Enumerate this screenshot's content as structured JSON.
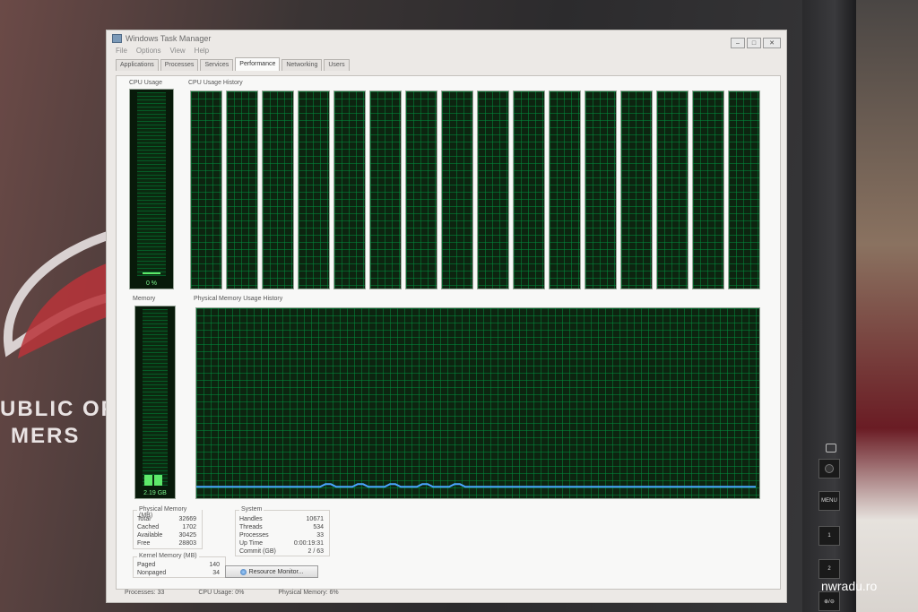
{
  "wallpaper": {
    "line1": "UBLIC OF",
    "line2": "MERS"
  },
  "monitor": {
    "buttons": [
      "MENU",
      "1",
      "2",
      "⊕/⊖"
    ]
  },
  "watermark": "nwradu.ro",
  "window": {
    "title": "Windows Task Manager",
    "controls": {
      "minimize": "–",
      "maximize": "□",
      "close": "✕"
    }
  },
  "menu": [
    "File",
    "Options",
    "View",
    "Help"
  ],
  "tabs": [
    "Applications",
    "Processes",
    "Services",
    "Performance",
    "Networking",
    "Users"
  ],
  "active_tab": "Performance",
  "performance": {
    "cpu_usage_label": "CPU Usage",
    "cpu_usage_value": "0 %",
    "cpu_history_label": "CPU Usage History",
    "cpu_cores": 16,
    "memory_label": "Memory",
    "memory_value": "2.19 GB",
    "phys_mem_history_label": "Physical Memory Usage History",
    "memory_history_percent": 6
  },
  "physical_memory": {
    "title": "Physical Memory (MB)",
    "rows": [
      {
        "label": "Total",
        "value": "32669"
      },
      {
        "label": "Cached",
        "value": "1702"
      },
      {
        "label": "Available",
        "value": "30425"
      },
      {
        "label": "Free",
        "value": "28803"
      }
    ]
  },
  "kernel_memory": {
    "title": "Kernel Memory (MB)",
    "rows": [
      {
        "label": "Paged",
        "value": "140"
      },
      {
        "label": "Nonpaged",
        "value": "34"
      }
    ]
  },
  "system": {
    "title": "System",
    "rows": [
      {
        "label": "Handles",
        "value": "10671"
      },
      {
        "label": "Threads",
        "value": "534"
      },
      {
        "label": "Processes",
        "value": "33"
      },
      {
        "label": "Up Time",
        "value": "0:00:19:31"
      },
      {
        "label": "Commit (GB)",
        "value": "2 / 63"
      }
    ]
  },
  "resource_monitor_button": "Resource Monitor...",
  "status": {
    "processes": "Processes: 33",
    "cpu": "CPU Usage: 0%",
    "memory": "Physical Memory: 6%"
  }
}
